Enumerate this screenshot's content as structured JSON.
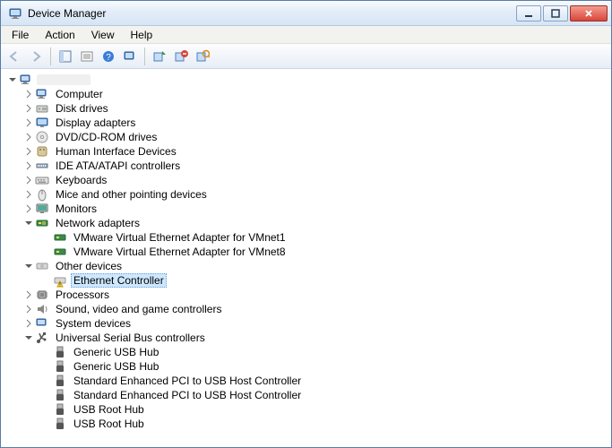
{
  "window": {
    "title": "Device Manager"
  },
  "menu": {
    "file": "File",
    "action": "Action",
    "view": "View",
    "help": "Help"
  },
  "toolbar": {
    "back": "back-icon",
    "forward": "forward-icon",
    "up": "up-icon",
    "show_hidden": "show-hidden-icon",
    "help": "help-icon",
    "refresh": "refresh-icon",
    "update": "update-driver-icon",
    "uninstall": "uninstall-icon",
    "scan": "scan-hardware-icon"
  },
  "tree": {
    "root": {
      "label": ""
    },
    "computer": "Computer",
    "disk_drives": "Disk drives",
    "display_adapters": "Display adapters",
    "dvd": "DVD/CD-ROM drives",
    "hid": "Human Interface Devices",
    "ide": "IDE ATA/ATAPI controllers",
    "keyboards": "Keyboards",
    "mice": "Mice and other pointing devices",
    "monitors": "Monitors",
    "network_adapters": "Network adapters",
    "net_vmnet1": "VMware Virtual Ethernet Adapter for VMnet1",
    "net_vmnet8": "VMware Virtual Ethernet Adapter for VMnet8",
    "other_devices": "Other devices",
    "ethernet_controller": "Ethernet Controller",
    "processors": "Processors",
    "sound": "Sound, video and game controllers",
    "system_devices": "System devices",
    "usb_controllers": "Universal Serial Bus controllers",
    "usb_generic_hub_1": "Generic USB Hub",
    "usb_generic_hub_2": "Generic USB Hub",
    "usb_std_pci_1": "Standard Enhanced PCI to USB Host Controller",
    "usb_std_pci_2": "Standard Enhanced PCI to USB Host Controller",
    "usb_root_hub_1": "USB Root Hub",
    "usb_root_hub_2": "USB Root Hub"
  }
}
